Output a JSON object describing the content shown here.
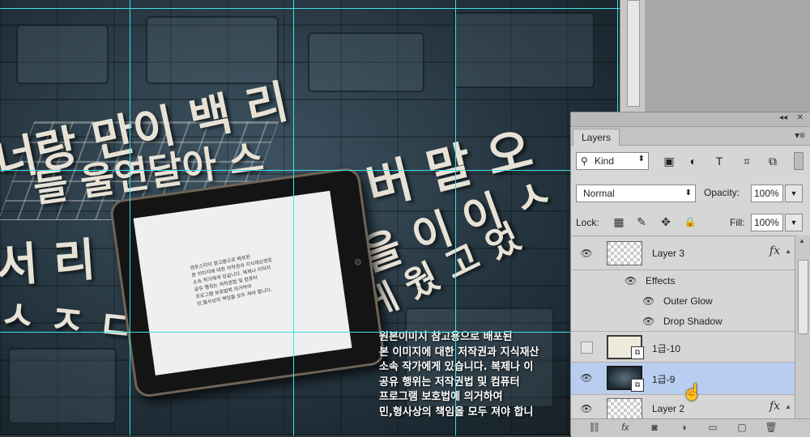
{
  "canvas": {
    "big_letters": [
      {
        "text": "너랑 만이 백 리"
      },
      {
        "text": "들 울연달아 스"
      },
      {
        "text": "버 말 오"
      },
      {
        "text": "을 이 이 ㅅ"
      },
      {
        "text": "서 리"
      },
      {
        "text": "게 웠 고 었"
      },
      {
        "text": "ㅅ ㅈ ㄷ 르"
      }
    ],
    "tablet_text": "엔포스터의 참고용으로 배포된\n본 이미지에 대한 저작권과 지식재산권은\n소속 작가에게 있습니다. 복제나 이미지\n공유 행위는 저작권법 및 컴퓨터\n프로그램 보호법에 의거하여\n민,형사상의 책임을 모두 져야 합니다.",
    "notice_lines": [
      "원본이미지 참고용으로 배포된",
      "본 이미지에 대한 저작권과 지식재산",
      "소속 작가에게 있습니다. 복제나 이",
      "공유 행위는 저작권법 및 컴퓨터",
      "프로그램 보호법에 의거하여",
      "민,형사상의 책임을 모두 져야 합니"
    ]
  },
  "panel": {
    "collapse_label": "◂◂",
    "close_label": "✕",
    "tab_label": "Layers",
    "menu_icon": "▾≡",
    "filter": {
      "search_icon": "⚲",
      "kind_label": "Kind",
      "dropdown_arrow": "⬍",
      "icons": [
        "▣",
        "◐",
        "T",
        "⌗",
        "⧉"
      ]
    },
    "blend_mode": "Normal",
    "opacity_label": "Opacity:",
    "opacity_value": "100%",
    "lock_label": "Lock:",
    "lock_icons": [
      "▦",
      "✎",
      "✥",
      "🔒"
    ],
    "fill_label": "Fill:",
    "fill_value": "100%",
    "arrow_down": "▼",
    "layers": [
      {
        "name": "Layer 3",
        "visible": true,
        "fx": "fx"
      },
      {
        "name": "1급-10",
        "visible": false,
        "fx": ""
      },
      {
        "name": "1급-9",
        "visible": true,
        "fx": "",
        "selected": true
      },
      {
        "name": "Layer 2",
        "visible": true,
        "fx": "fx"
      }
    ],
    "effects_label": "Effects",
    "effects": [
      "Outer Glow",
      "Drop Shadow"
    ],
    "eye_icon": "👁",
    "smart_badge": "⧉",
    "fx_arrow": "▲",
    "bottom_icons": [
      "⛓",
      "fx",
      "◙",
      "◑",
      "▭",
      "▢",
      "🗑"
    ]
  },
  "colors": {
    "guide": "#3fe0e8",
    "selected_layer": "#b8cdf0",
    "panel_bg": "#d6d6d6"
  }
}
